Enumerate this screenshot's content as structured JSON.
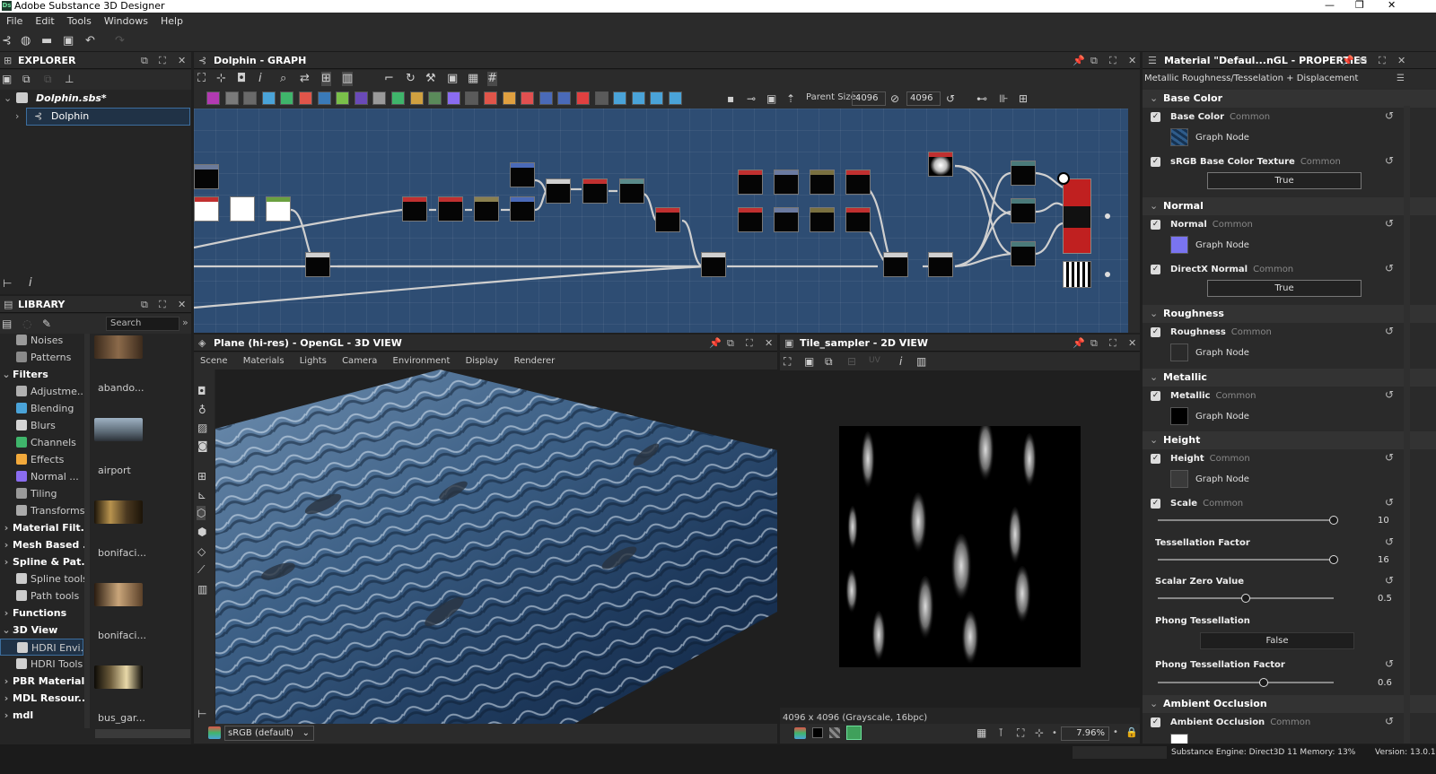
{
  "app": {
    "title": "Adobe Substance 3D Designer"
  },
  "menu": [
    "File",
    "Edit",
    "Tools",
    "Windows",
    "Help"
  ],
  "explorer": {
    "title": "EXPLORER",
    "file": "Dolphin.sbs*",
    "graph_item": "Dolphin"
  },
  "library": {
    "title": "LIBRARY",
    "search_placeholder": "Search",
    "categories": [
      {
        "label": "Noises",
        "type": "item",
        "color": "#9a9a9a"
      },
      {
        "label": "Patterns",
        "type": "item",
        "color": "#8a8a8a"
      },
      {
        "label": "Filters",
        "type": "header"
      },
      {
        "label": "Adjustme...",
        "type": "item",
        "color": "#b0b0b0"
      },
      {
        "label": "Blending",
        "type": "item",
        "color": "#4aa3d8"
      },
      {
        "label": "Blurs",
        "type": "item",
        "color": "#d4d4d4"
      },
      {
        "label": "Channels",
        "type": "item",
        "color": "#3fb56b"
      },
      {
        "label": "Effects",
        "type": "item",
        "color": "#f2a93b"
      },
      {
        "label": "Normal ...",
        "type": "item",
        "color": "#8a6cf0"
      },
      {
        "label": "Tiling",
        "type": "item",
        "color": "#9a9a9a"
      },
      {
        "label": "Transforms",
        "type": "item",
        "color": "#aaaaaa"
      },
      {
        "label": "Material Filt...",
        "type": "header"
      },
      {
        "label": "Mesh Based ...",
        "type": "header"
      },
      {
        "label": "Spline & Pat...",
        "type": "header"
      },
      {
        "label": "Spline tools",
        "type": "item",
        "color": "#cccccc"
      },
      {
        "label": "Path tools",
        "type": "item",
        "color": "#cccccc"
      },
      {
        "label": "Functions",
        "type": "header"
      },
      {
        "label": "3D View",
        "type": "header"
      },
      {
        "label": "HDRI Envi...",
        "type": "item",
        "color": "#d0d0d0"
      },
      {
        "label": "HDRI Tools",
        "type": "item",
        "color": "#d0d0d0"
      },
      {
        "label": "PBR Materials",
        "type": "header"
      },
      {
        "label": "MDL Resour...",
        "type": "header"
      },
      {
        "label": "mdl",
        "type": "header"
      }
    ],
    "thumbs": [
      "abando...",
      "airport",
      "bonifaci...",
      "bonifaci...",
      "bus_gar..."
    ]
  },
  "graph": {
    "title": "Dolphin - GRAPH",
    "parent_size_label": "Parent Size:",
    "parent_size": "4096",
    "size": "4096"
  },
  "view3d": {
    "title": "Plane (hi-res) - OpenGL - 3D VIEW",
    "menu": [
      "Scene",
      "Materials",
      "Lights",
      "Camera",
      "Environment",
      "Display",
      "Renderer"
    ],
    "colorspace": "sRGB (default)"
  },
  "view2d": {
    "title": "Tile_sampler - 2D VIEW",
    "uv_label": "UV",
    "info": "4096 x 4096 (Grayscale, 16bpc)",
    "zoom": "7.96%"
  },
  "properties": {
    "title": "Material \"Defaul...nGL - PROPERTIES",
    "subtitle": "Metallic Roughness/Tesselation + Displacement",
    "common": "Common",
    "graph_node": "Graph Node",
    "sections": {
      "base_color": "Base Color",
      "normal": "Normal",
      "roughness": "Roughness",
      "metallic": "Metallic",
      "height": "Height",
      "ao": "Ambient Occlusion"
    },
    "params": {
      "base_color": "Base Color",
      "srgb": "sRGB Base Color Texture",
      "srgb_val": "True",
      "normal": "Normal",
      "directx": "DirectX Normal",
      "directx_val": "True",
      "roughness": "Roughness",
      "metallic": "Metallic",
      "height": "Height",
      "scale": "Scale",
      "scale_val": "10",
      "tess": "Tessellation Factor",
      "tess_val": "16",
      "szero": "Scalar Zero Value",
      "szero_val": "0.5",
      "phong": "Phong Tessellation",
      "phong_val": "False",
      "phong_factor": "Phong Tessellation Factor",
      "phong_factor_val": "0.6",
      "ao": "Ambient Occlusion"
    }
  },
  "status": {
    "engine": "Substance Engine: Direct3D 11 Memory: 13%",
    "version": "Version: 13.0.1"
  }
}
